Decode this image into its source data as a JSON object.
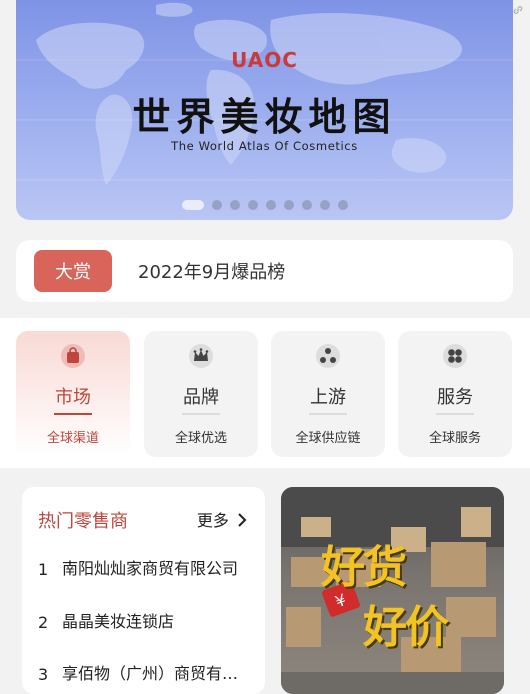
{
  "banner": {
    "logo_text": "UAOC",
    "headline": "世界美妆地图",
    "subtitle": "The World Atlas Of Cosmetics",
    "dot_count": 9,
    "active_dot": 0,
    "link_icon": "link-icon"
  },
  "award": {
    "badge": "大赏",
    "text": "2022年9月爆品榜"
  },
  "categories": [
    {
      "title": "市场",
      "subtitle": "全球渠道",
      "icon": "shopping-bag-icon",
      "active": true
    },
    {
      "title": "品牌",
      "subtitle": "全球优选",
      "icon": "crown-icon",
      "active": false
    },
    {
      "title": "上游",
      "subtitle": "全球供应链",
      "icon": "supply-chain-icon",
      "active": false
    },
    {
      "title": "服务",
      "subtitle": "全球服务",
      "icon": "clover-icon",
      "active": false
    }
  ],
  "retailers": {
    "title": "热门零售商",
    "more": "更多",
    "items": [
      {
        "rank": "1",
        "name": "南阳灿灿家商贸有限公司"
      },
      {
        "rank": "2",
        "name": "晶晶美妆连锁店"
      },
      {
        "rank": "3",
        "name": "享佰物（广州）商贸有限公司"
      }
    ]
  },
  "promo": {
    "line1": "好货",
    "line2": "好价"
  },
  "colors": {
    "accent": "#c0453c",
    "badge": "#d9655a",
    "banner": "#8a9ce9",
    "promo_text": "#f2c324"
  }
}
